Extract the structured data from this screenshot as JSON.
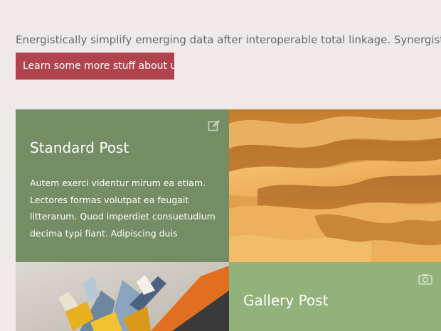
{
  "intro": {
    "text": "Energistically simplify emerging data after interoperable total linkage. Synergistically"
  },
  "cta": {
    "label": "Learn some more stuff about us"
  },
  "posts": [
    {
      "title": "Standard Post",
      "excerpt": "Autem exerci videntur mirum ea etiam. Lectores formas volutpat ea feugait litterarum. Quod imperdiet consuetudium decima typi fiant. Adipiscing duis",
      "icon": "edit-icon"
    },
    {
      "image": "desert-dunes-image"
    },
    {
      "image": "abstract-shards-image"
    },
    {
      "title": "Gallery Post",
      "icon": "camera-icon"
    }
  ],
  "colors": {
    "background": "#efe9ea",
    "button": "#b0434d",
    "standard_tile": "#748d65",
    "gallery_tile": "#91b279"
  }
}
